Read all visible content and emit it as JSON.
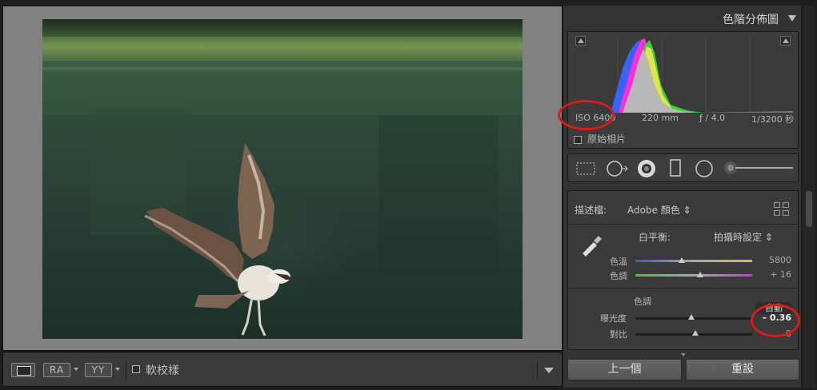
{
  "loupe": {
    "photo_subject": "osprey-photo"
  },
  "toolbar": {
    "ra_label": "RA",
    "yy_label": "YY",
    "softproof_label": "軟校樣"
  },
  "histogram": {
    "title": "色階分佈圖",
    "iso": "ISO 6400",
    "focal": "220 mm",
    "aperture": "ƒ / 4.0",
    "shutter": "1/3200 秒",
    "original_photo_label": "原始相片"
  },
  "basic": {
    "profile_label": "描述檔:",
    "profile_value": "Adobe 顏色 ⇕",
    "wb_label": "白平衡:",
    "wb_value": "拍攝時設定 ⇕",
    "temp_label": "色溫",
    "temp_value": "5800",
    "tint_label": "色調",
    "tint_value": "+ 16",
    "tone_label": "色調",
    "auto_label": "自動",
    "exposure_label": "曝光度",
    "exposure_value": "– 0.36",
    "contrast_label": "對比",
    "contrast_value": "0"
  },
  "buttons": {
    "prev": "上一個",
    "reset": "重設"
  },
  "colors": {
    "annotation": "#e01818",
    "panel": "#333333"
  }
}
